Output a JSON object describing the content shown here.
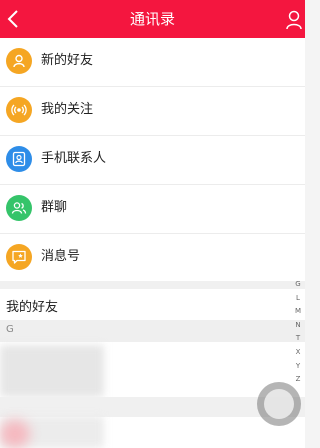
{
  "header": {
    "title": "通讯录",
    "back_icon": "chevron-left-icon",
    "right_icon": "person-icon",
    "color": "#f4163f"
  },
  "menu": {
    "items": [
      {
        "label": "新的好友",
        "icon": "user-icon",
        "color": "#f5a623"
      },
      {
        "label": "我的关注",
        "icon": "broadcast-icon",
        "color": "#f5a623"
      },
      {
        "label": "手机联系人",
        "icon": "contact-card-icon",
        "color": "#2e8de8"
      },
      {
        "label": "群聊",
        "icon": "group-icon",
        "color": "#35c46a"
      },
      {
        "label": "消息号",
        "icon": "message-account-icon",
        "color": "#f5a623"
      }
    ]
  },
  "friends": {
    "title": "我的好友",
    "section_letter": "G"
  },
  "index_letters": [
    "G",
    "L",
    "M",
    "N",
    "T",
    "X",
    "Y",
    "Z"
  ]
}
